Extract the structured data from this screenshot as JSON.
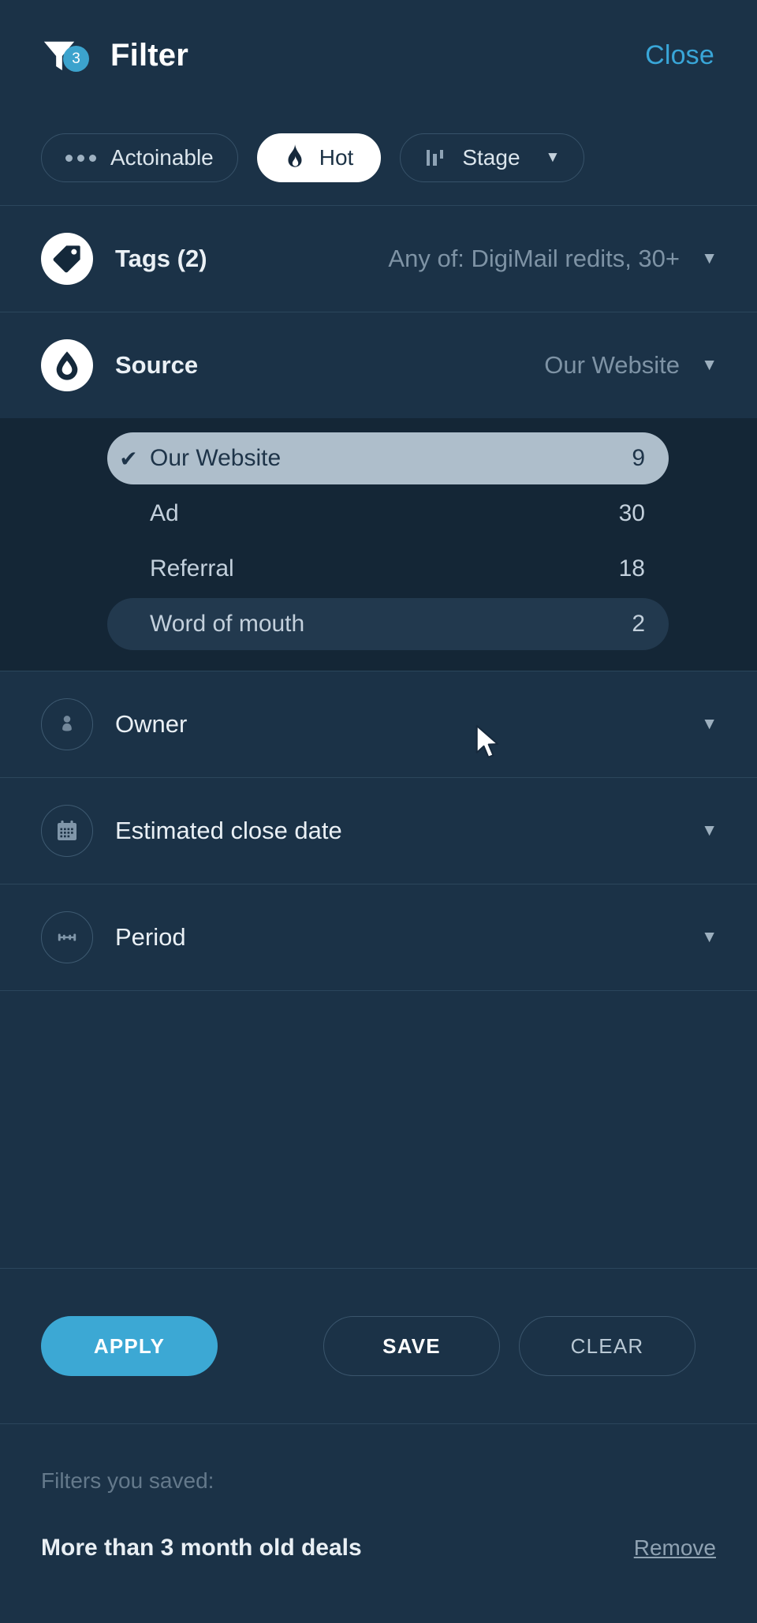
{
  "header": {
    "title": "Filter",
    "badge_count": "3",
    "close_label": "Close",
    "accent_color": "#39a6d8"
  },
  "chips": [
    {
      "label": "Actoinable",
      "icon": "dots-icon",
      "active": false,
      "caret": ""
    },
    {
      "label": "Hot",
      "icon": "flame-icon",
      "active": true,
      "caret": ""
    },
    {
      "label": "Stage",
      "icon": "stage-bars-icon",
      "active": false,
      "caret": "▼"
    }
  ],
  "rows": {
    "tags": {
      "label": "Tags (2)",
      "value": "Any of:  DigiMail redits,  30+",
      "caret": "▼",
      "icon": "tag-icon"
    },
    "source": {
      "label": "Source",
      "value": "Our Website",
      "caret": "▼",
      "icon": "droplet-icon"
    },
    "owner": {
      "label": "Owner",
      "value": "",
      "caret": "▼",
      "icon": "person-icon"
    },
    "close_date": {
      "label": "Estimated close date",
      "value": "",
      "caret": "▼",
      "icon": "calendar-icon"
    },
    "period": {
      "label": "Period",
      "value": "",
      "caret": "▼",
      "icon": "range-icon"
    }
  },
  "source_options": [
    {
      "label": "Our Website",
      "count": "9",
      "selected": true,
      "hovered": false,
      "check": "✔"
    },
    {
      "label": "Ad",
      "count": "30",
      "selected": false,
      "hovered": false,
      "check": ""
    },
    {
      "label": "Referral",
      "count": "18",
      "selected": false,
      "hovered": false,
      "check": ""
    },
    {
      "label": "Word of mouth",
      "count": "2",
      "selected": false,
      "hovered": true,
      "check": ""
    }
  ],
  "actions": {
    "apply_label": "APPLY",
    "save_label": "SAVE",
    "clear_label": "CLEAR",
    "apply_color": "#3ca8d4"
  },
  "saved": {
    "heading": "Filters you saved:",
    "items": [
      {
        "name": "More than 3 month old deals",
        "remove_label": "Remove"
      }
    ]
  }
}
